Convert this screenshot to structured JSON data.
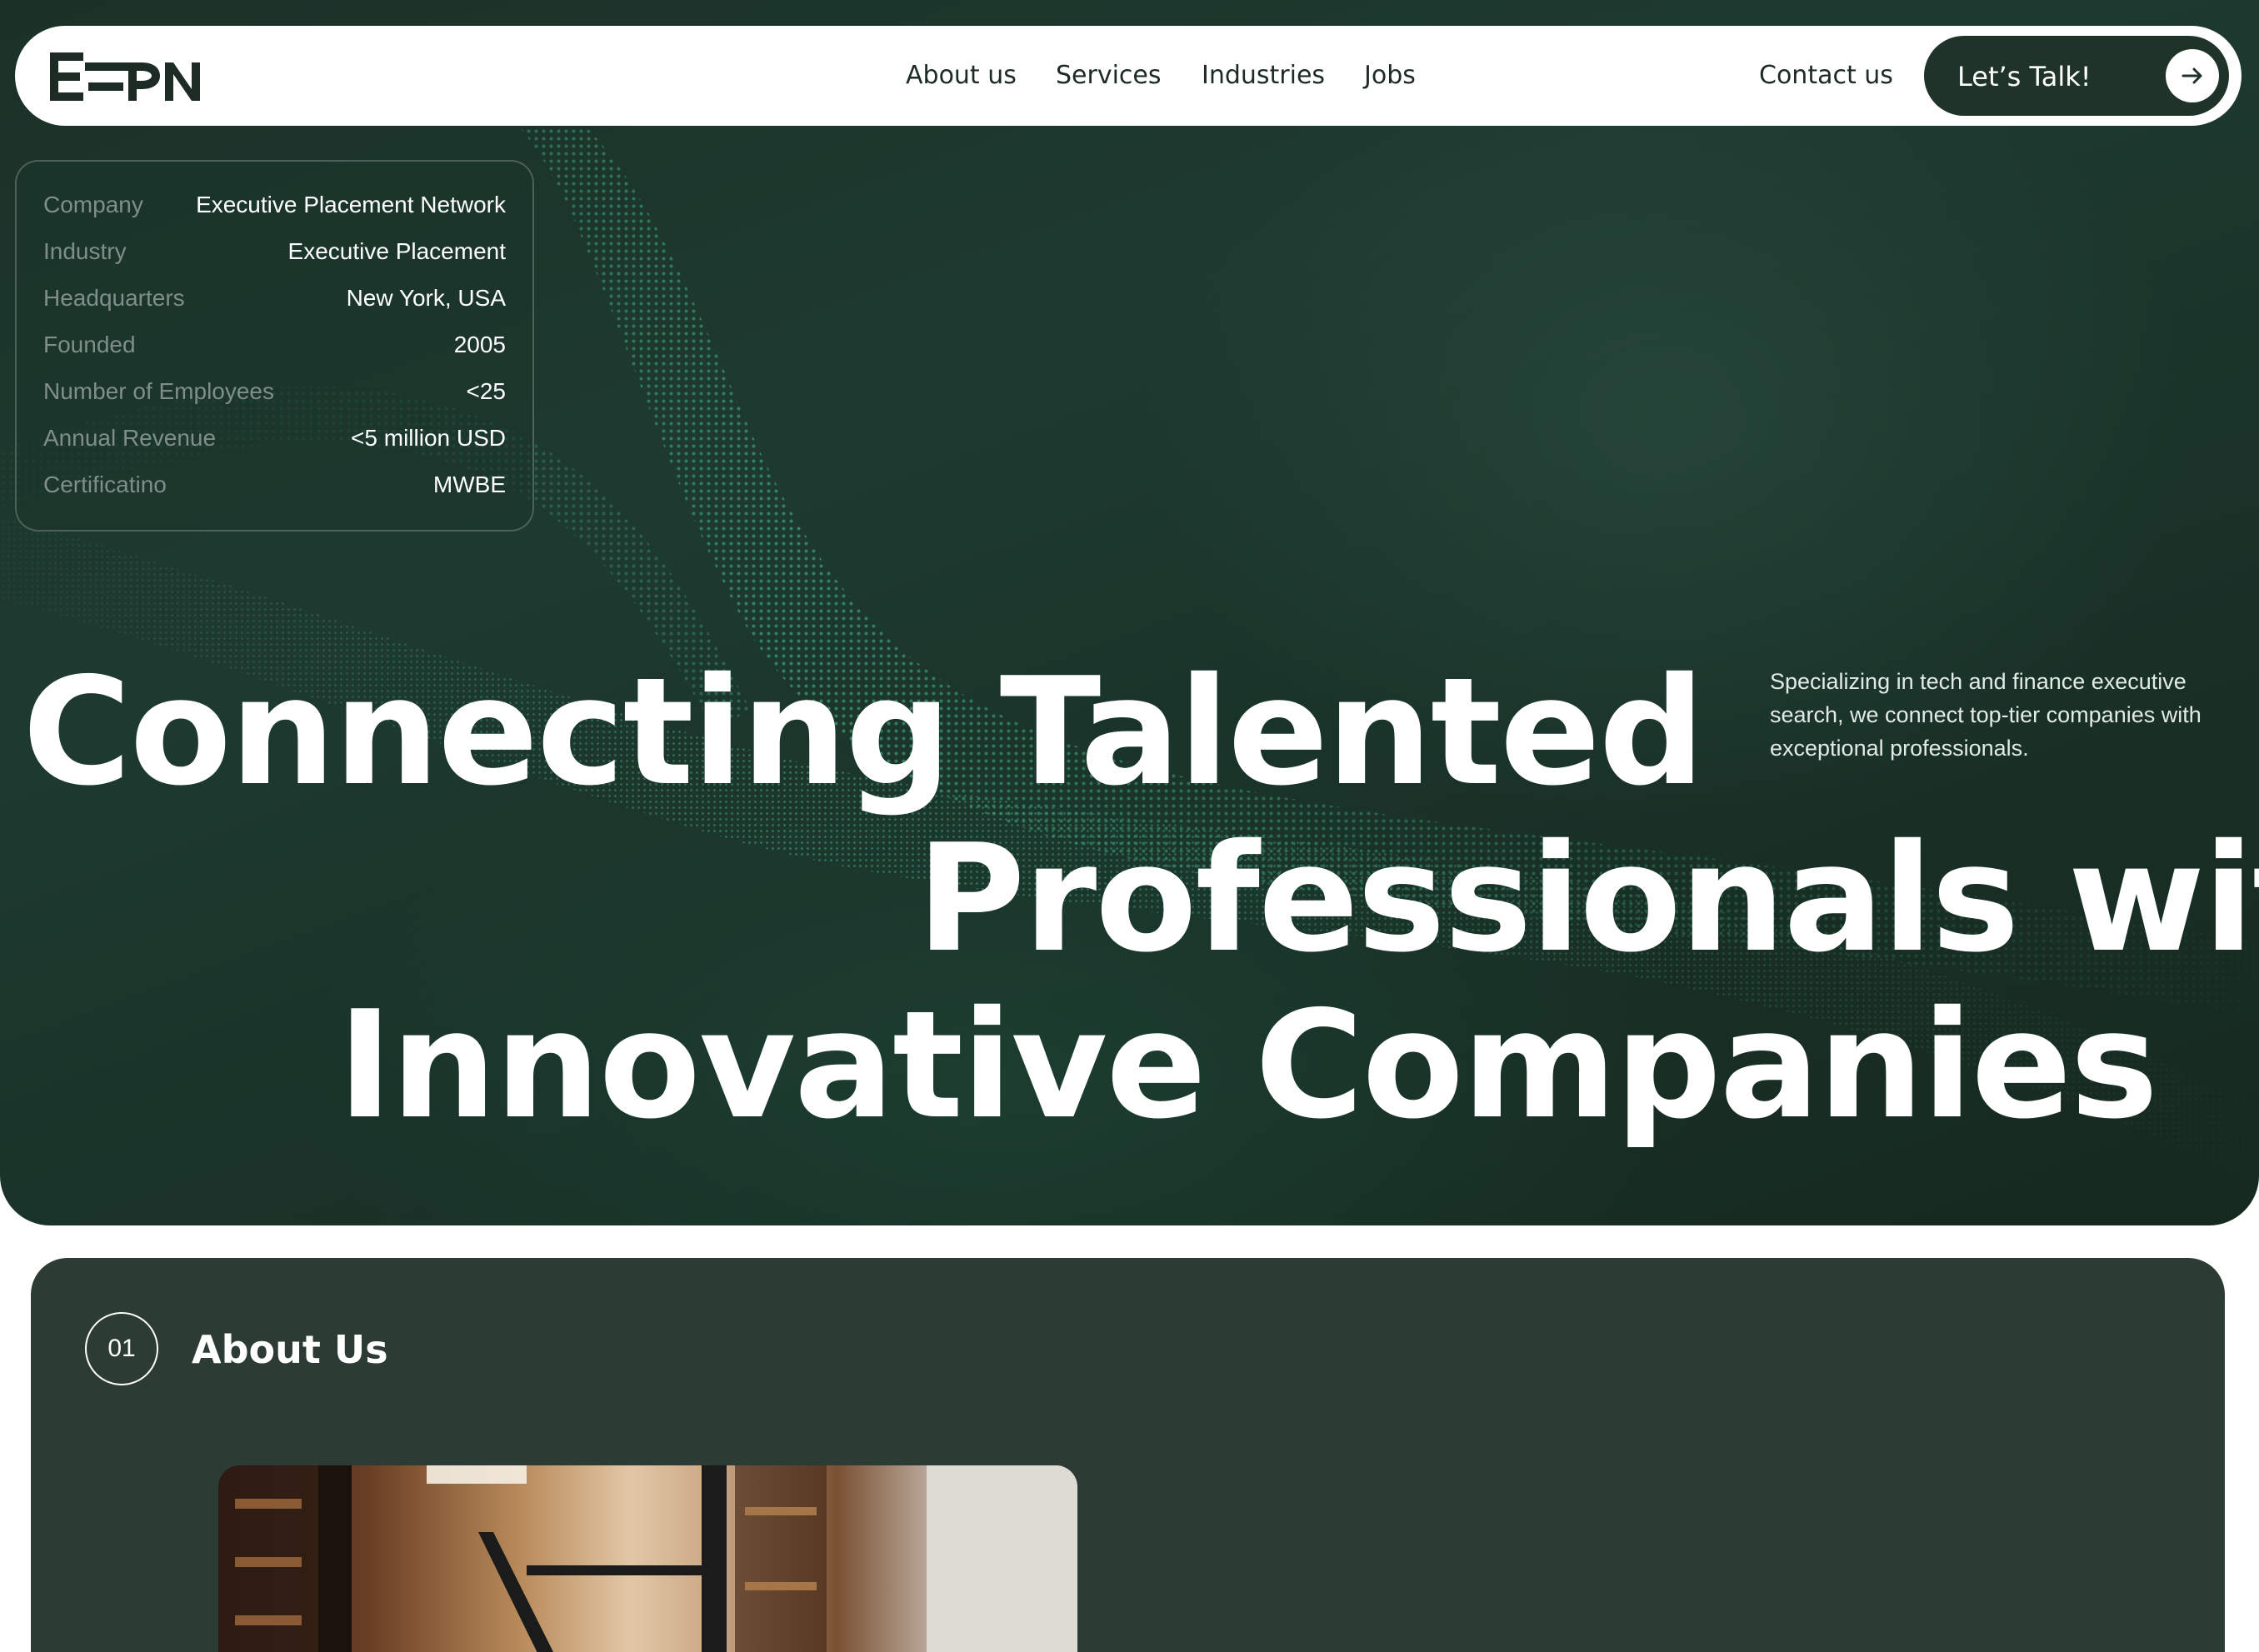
{
  "nav": {
    "logo_text": "EEPN",
    "links": [
      "About us",
      "Services",
      "Industries",
      "Jobs"
    ],
    "contact": "Contact us",
    "cta": "Let’s Talk!",
    "cta_icon": "arrow-right-icon"
  },
  "company_info": {
    "rows": [
      {
        "label": "Company",
        "value": "Executive Placement Network"
      },
      {
        "label": "Industry",
        "value": "Executive Placement"
      },
      {
        "label": "Headquarters",
        "value": "New York, USA"
      },
      {
        "label": "Founded",
        "value": "2005"
      },
      {
        "label": "Number of Employees",
        "value": "<25"
      },
      {
        "label": "Annual Revenue",
        "value": "<5 million USD"
      },
      {
        "label": "Certificatino",
        "value": "MWBE"
      }
    ]
  },
  "hero": {
    "headline": [
      "Connecting Talented",
      "Professionals with",
      "Innovative Companies"
    ],
    "tagline": "Specializing in tech and finance executive search, we connect top-tier companies with exceptional professionals."
  },
  "about": {
    "number": "01",
    "title": "About Us"
  },
  "colors": {
    "hero_bg": "#1b3128",
    "accent_dots": "#3fa77c",
    "panel_bg": "#2c3b33",
    "button_bg": "#1f3328"
  }
}
